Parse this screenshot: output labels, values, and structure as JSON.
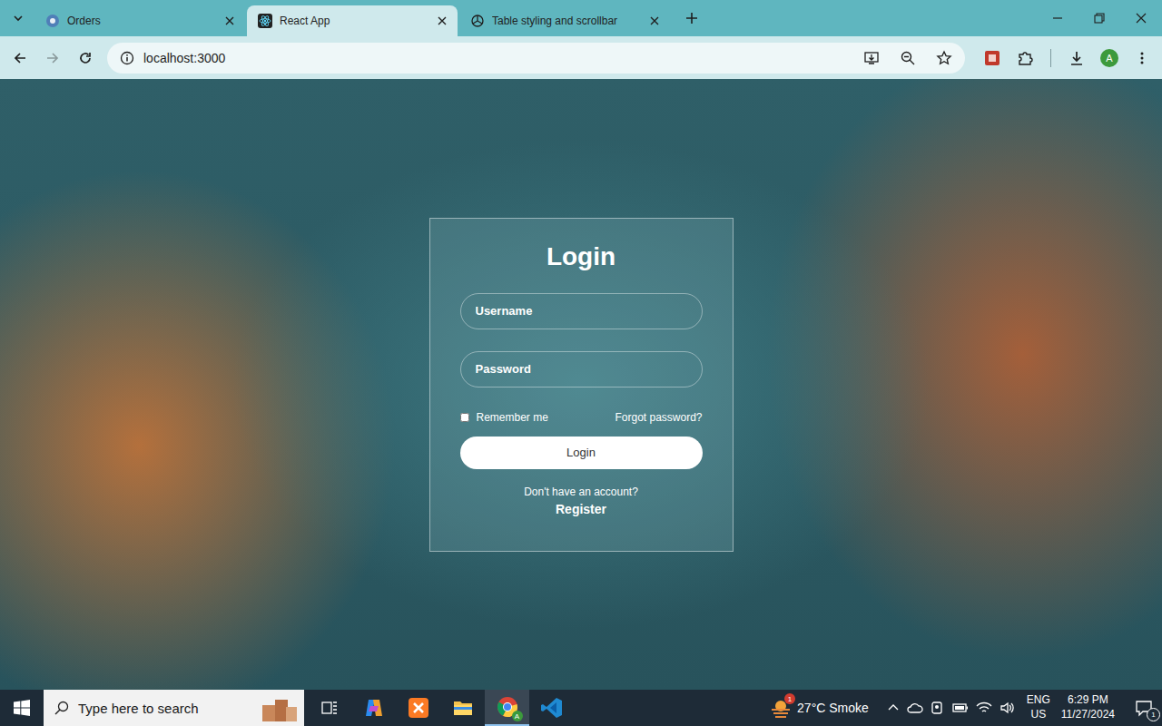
{
  "browser": {
    "tabs": [
      {
        "label": "Orders",
        "selected": false,
        "kind": "site"
      },
      {
        "label": "React App",
        "selected": true,
        "kind": "react"
      },
      {
        "label": "Table styling and scrollbar",
        "selected": false,
        "kind": "chatgpt"
      }
    ],
    "address": "localhost:3000",
    "profile": "A"
  },
  "page": {
    "title": "Login",
    "fields": [
      {
        "placeholder": "Username",
        "kind": "text"
      },
      {
        "placeholder": "Password",
        "kind": "password"
      }
    ],
    "remember": {
      "label": "Remember me",
      "checked": false
    },
    "forgot": "Forgot password?",
    "submit": "Login",
    "prompt": "Don't have an account?",
    "register": "Register"
  },
  "taskbar": {
    "search": {
      "placeholder": "Type here to search"
    },
    "apps": [
      {
        "kind": "taskview",
        "selected": false
      },
      {
        "kind": "copilot",
        "selected": false
      },
      {
        "kind": "xampp",
        "selected": false
      },
      {
        "kind": "explorer",
        "selected": false
      },
      {
        "kind": "chrome",
        "selected": true,
        "badge": "A"
      },
      {
        "kind": "vscode",
        "selected": false
      }
    ],
    "weather": {
      "reading": "27°C Smoke",
      "badge": "1"
    },
    "language": "ENG",
    "region": "US",
    "time": "6:29 PM",
    "date": "11/27/2024",
    "notifications": "1"
  }
}
